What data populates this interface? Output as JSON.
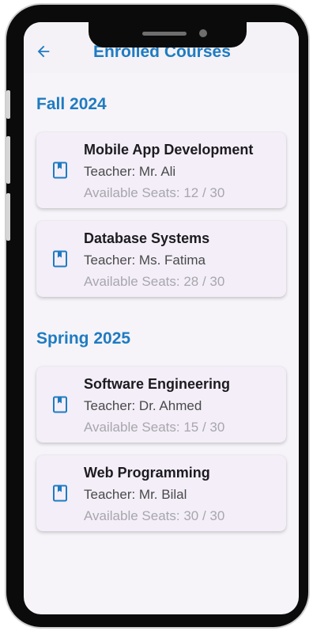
{
  "appbar": {
    "title": "Enrolled Courses"
  },
  "sections": [
    {
      "title": "Fall 2024",
      "courses": [
        {
          "name": "Mobile App Development",
          "teacher": "Teacher: Mr. Ali",
          "seats": "Available Seats: 12 / 30"
        },
        {
          "name": "Database Systems",
          "teacher": "Teacher: Ms. Fatima",
          "seats": "Available Seats: 28 / 30"
        }
      ]
    },
    {
      "title": "Spring 2025",
      "courses": [
        {
          "name": "Software Engineering",
          "teacher": "Teacher: Dr. Ahmed",
          "seats": "Available Seats: 15 / 30"
        },
        {
          "name": "Web Programming",
          "teacher": "Teacher: Mr. Bilal",
          "seats": "Available Seats: 30 / 30"
        }
      ]
    }
  ],
  "icons": {
    "back": "arrow-back-icon",
    "course": "book-icon"
  },
  "colors": {
    "accent": "#1f7bc2",
    "card_bg": "#f3eef8",
    "screen_bg": "#f6f4f8"
  }
}
